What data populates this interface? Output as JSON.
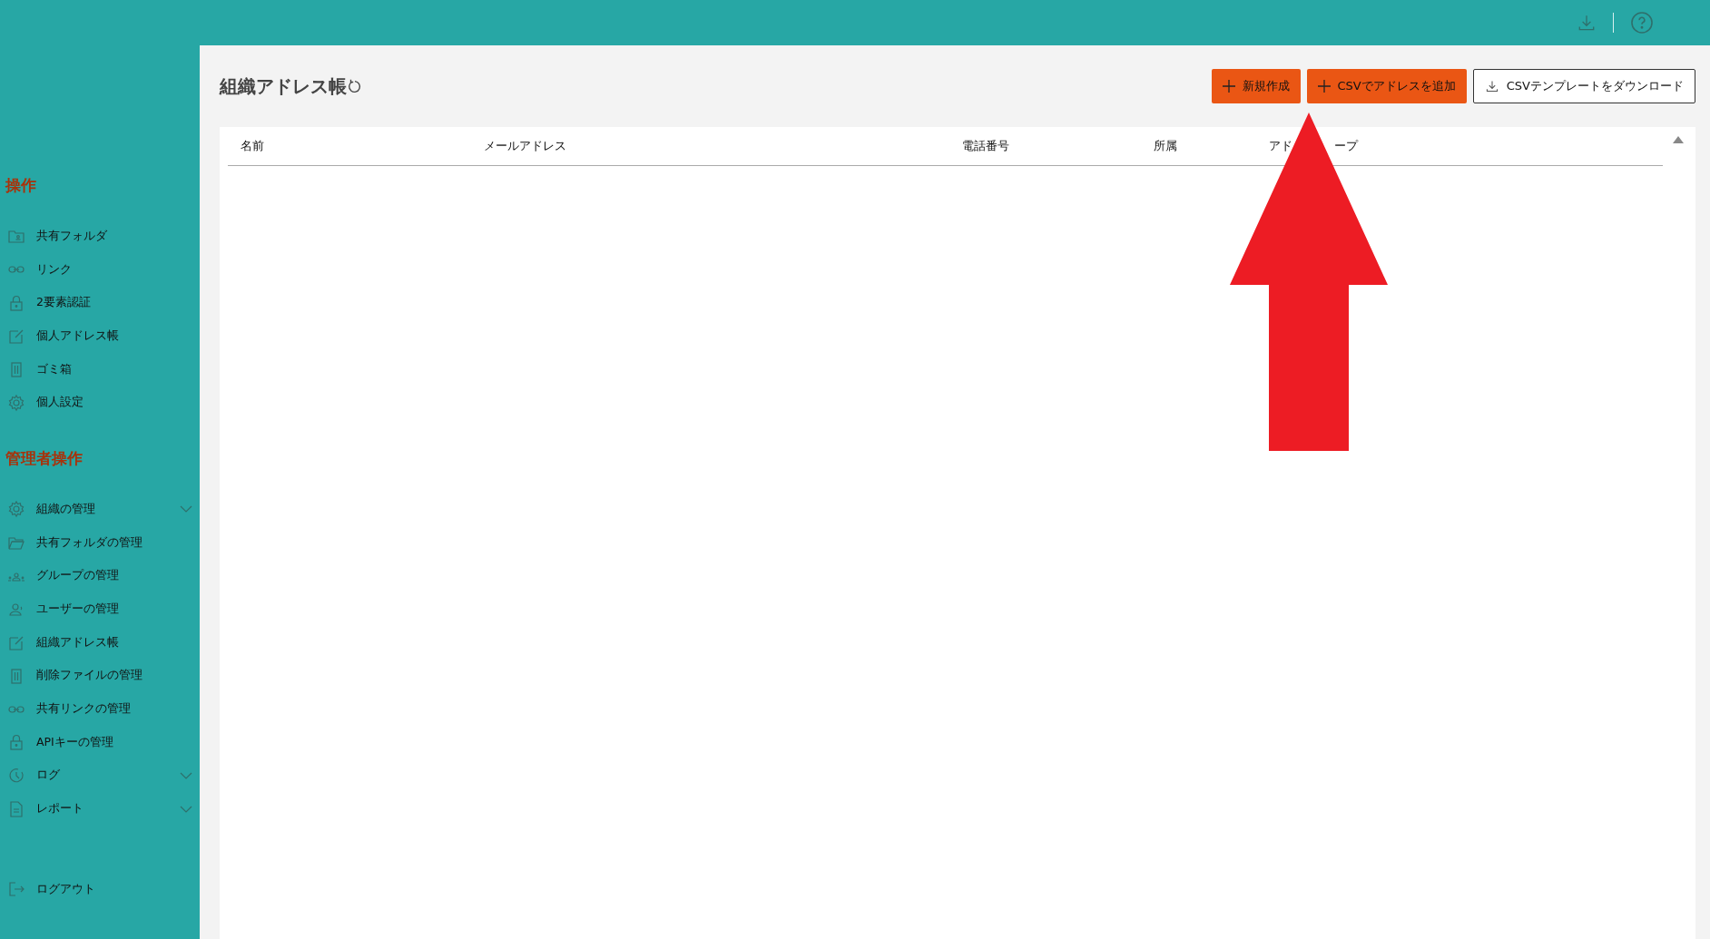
{
  "sidebar": {
    "sections": [
      {
        "title": "操作",
        "items": [
          {
            "label": "共有フォルダ",
            "expandable": false
          },
          {
            "label": "リンク",
            "expandable": false
          },
          {
            "label": "2要素認証",
            "expandable": false
          },
          {
            "label": "個人アドレス帳",
            "expandable": false
          },
          {
            "label": "ゴミ箱",
            "expandable": false
          },
          {
            "label": "個人設定",
            "expandable": false
          }
        ]
      },
      {
        "title": "管理者操作",
        "items": [
          {
            "label": "組織の管理",
            "expandable": true
          },
          {
            "label": "共有フォルダの管理",
            "expandable": false
          },
          {
            "label": "グループの管理",
            "expandable": false
          },
          {
            "label": "ユーザーの管理",
            "expandable": false
          },
          {
            "label": "組織アドレス帳",
            "expandable": false
          },
          {
            "label": "削除ファイルの管理",
            "expandable": false
          },
          {
            "label": "共有リンクの管理",
            "expandable": false
          },
          {
            "label": "APIキーの管理",
            "expandable": false
          },
          {
            "label": "ログ",
            "expandable": true
          },
          {
            "label": "レポート",
            "expandable": true
          }
        ]
      }
    ],
    "logout": "ログアウト"
  },
  "page": {
    "title": "組織アドレス帳"
  },
  "buttons": [
    {
      "label": "新規作成",
      "kind": "primary"
    },
    {
      "label": "CSVでアドレスを追加",
      "kind": "primary"
    },
    {
      "label": "CSVテンプレートをダウンロード",
      "kind": "outline"
    }
  ],
  "table": {
    "columns": [
      {
        "parts": [
          "名前"
        ]
      },
      {
        "parts": [
          "メールアドレス"
        ]
      },
      {
        "parts": [
          "電話番号"
        ]
      },
      {
        "parts": [
          "所属"
        ]
      },
      {
        "parts": [
          "アド",
          "ープ"
        ]
      }
    ]
  }
}
